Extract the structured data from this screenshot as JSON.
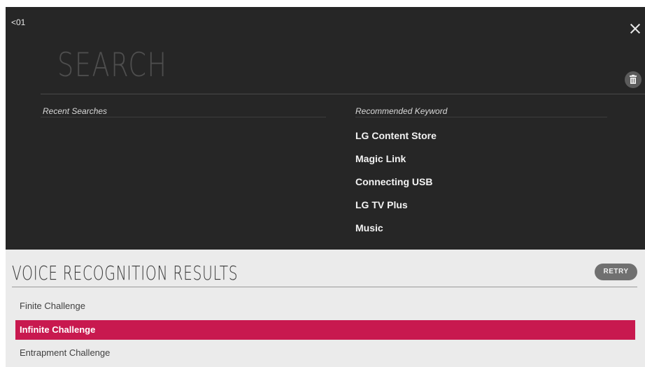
{
  "header": {
    "back_label": "<01"
  },
  "search": {
    "title": "SEARCH"
  },
  "recent": {
    "title": "Recent Searches"
  },
  "recommended": {
    "title": "Recommended Keyword",
    "items": [
      "LG Content Store",
      "Magic Link",
      "Connecting USB",
      "LG TV Plus",
      "Music"
    ]
  },
  "voice": {
    "title": "VOICE RECOGNITION RESULTS",
    "retry_label": "RETRY",
    "results": [
      "Finite Challenge",
      "Infinite Challenge",
      "Entrapment Challenge"
    ],
    "selected_result": "Infinite Challenge"
  },
  "colors": {
    "accent": "#c8194f",
    "panel_dark": "#262626",
    "panel_light": "#ebebeb"
  },
  "icons": {
    "close": "close-icon",
    "delete_history": "trash-icon"
  }
}
